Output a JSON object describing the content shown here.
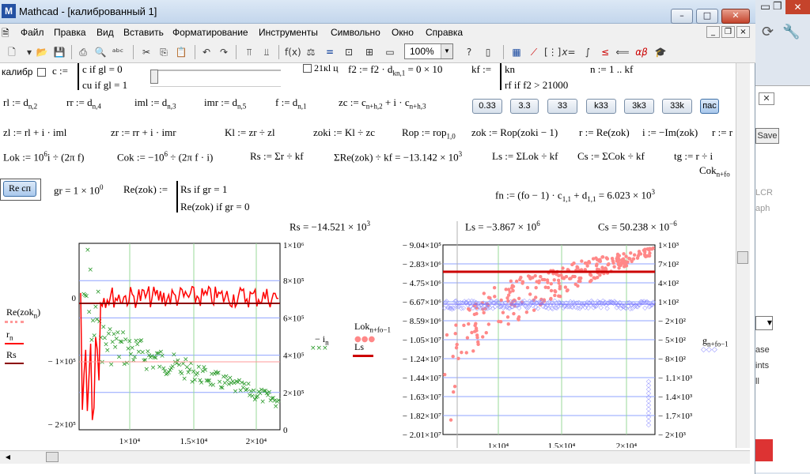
{
  "window": {
    "title": "Mathcad - [калиброванный 1]",
    "app_icon": "M"
  },
  "menu": [
    "Файл",
    "Правка",
    "Вид",
    "Вставить",
    "Форматирование",
    "Инструменты",
    "Символьно",
    "Окно",
    "Справка"
  ],
  "zoom": "100%",
  "sheet": {
    "row1": {
      "calib_label": "калибр",
      "cond1": "c if gl = 0",
      "cond2": "cu if gl = 1",
      "checkbox_label": "21кl ц",
      "f2_def": "f2 := f2 · d",
      "f2_sub": "kn,1",
      "f2_rest": " = 0 × 10",
      "kf": "kf :=",
      "kf1": "kn",
      "kf2": "rf  if  f2 > 21000",
      "nrange": "n := 1 .. kf"
    },
    "buttons": [
      "0.33",
      "3.3",
      "33",
      "k33",
      "3k3",
      "33k",
      "пас"
    ],
    "defs_row2": [
      "rl",
      "rr",
      "iml",
      "imr",
      "f",
      "zc"
    ],
    "row2": {
      "rl": "rl := d",
      "rl_sub": "n,2",
      "rr": "rr := d",
      "rr_sub": "n,4",
      "iml": "iml := d",
      "iml_sub": "n,3",
      "imr": "imr := d",
      "imr_sub": "n,5",
      "f": "f := d",
      "f_sub": "n,1",
      "zc": "zc := c",
      "zc_sub": "n+h,2",
      "zc_rest": " + i · c",
      "zc_sub2": "n+h,3"
    },
    "row3": {
      "zl": "zl := rl + i · iml",
      "zr": "zr := rr + i · imr",
      "kl": "Kl := zr ÷ zl",
      "zoki": "zoki := Kl ÷ zc",
      "rop": "Rop := rop",
      "rop_sub": "1,0",
      "zok": "zok := Rop(zoki − 1)",
      "r": "r := Re(zok)",
      "i": "i := −Im(zok)",
      "tail": "r := r"
    },
    "row4": {
      "lok": "Lok := 10",
      "lok_exp": "6",
      "lok_rest": "i ÷ (2π f)",
      "cok": "Cok := −10",
      "cok_exp": "6",
      "cok_rest": " ÷ (2π f · i)",
      "rs": "Rs := Σr ÷ kf",
      "re_sum": "ΣRe(zok) ÷ kf = −13.142 × 10",
      "re_sum_exp": "3",
      "ls": "Ls := ΣLok ÷ kf",
      "cs": "Cs := ΣCok ÷ kf",
      "tg": "tg := r ÷ i",
      "cok_tail": "Cok",
      "cok_tail_sub": "n+fo"
    },
    "row5": {
      "recsp_button": "Re сп",
      "gr": "gr = 1 × 10",
      "gr_exp": "0",
      "rez": "Re(zok) :=",
      "rez1": "Rs  if  gr = 1",
      "rez2": "Re(zok)  if  gr = 0",
      "fn": "fn := (fo − 1) · c",
      "fn_sub": "1,1",
      "fn_rest": " + d",
      "fn_sub2": "1,1",
      "fn_val": " = 6.023 × 10",
      "fn_exp": "3"
    },
    "results": {
      "rs": "Rs = −14.521 × 10",
      "rs_exp": "3",
      "ls": "Ls = −3.867 × 10",
      "ls_exp": "6",
      "cs": "Cs = 50.238 × 10",
      "cs_exp": "−6"
    }
  },
  "chart_data": [
    {
      "type": "line",
      "x_ticks": [
        "1×10⁴",
        "1.5×10⁴",
        "2×10⁴"
      ],
      "y_left_ticks": [
        "0",
        "− 1×10⁵",
        "− 2×10⁵"
      ],
      "y_right_ticks": [
        "1×10⁶",
        "8×10⁵",
        "6×10⁵",
        "4×10⁵",
        "2×10⁵",
        "0"
      ],
      "series": [
        {
          "name": "Re(zok_n)",
          "color": "#ff9999"
        },
        {
          "name": "r_n",
          "color": "#ff0000"
        },
        {
          "name": "Rs",
          "color": "#aa0000"
        },
        {
          "name": "− i_n",
          "color": "#2a9a2a"
        }
      ],
      "legend_left": [
        "Re(zok",
        "n",
        ")",
        "r",
        "n",
        "Rs"
      ],
      "legend_right": [
        "− i",
        "n"
      ]
    },
    {
      "type": "scatter",
      "x_ticks": [
        "1×10⁴",
        "1.5×10⁴",
        "2×10⁴"
      ],
      "y_left_ticks": [
        "− 9.04×10⁵",
        "− 2.83×10⁶",
        "− 4.75×10⁶",
        "− 6.67×10⁶",
        "− 8.59×10⁶",
        "− 1.05×10⁷",
        "− 1.24×10⁷",
        "− 1.44×10⁷",
        "− 1.63×10⁷",
        "− 1.82×10⁷",
        "− 2.01×10⁷"
      ],
      "y_right_ticks": [
        "1×10³",
        "7×10²",
        "4×10²",
        "1×10²",
        "− 2×10²",
        "− 5×10²",
        "− 8×10²",
        "− 1.1×10³",
        "− 1.4×10³",
        "− 1.7×10³",
        "− 2×10³"
      ],
      "series": [
        {
          "name": "Lok_(n+fo−1)",
          "color": "#ff8888"
        },
        {
          "name": "Ls",
          "color": "#cc0000"
        },
        {
          "name": "g_(n+fo−1)",
          "color": "#8888ff"
        }
      ],
      "legend_left": [
        "Lok",
        "n+fo−1",
        "Ls"
      ],
      "legend_right": [
        "g",
        "n+fo−1"
      ]
    }
  ],
  "right_panel": {
    "labels": [
      "Save",
      "LCR",
      "aph",
      "ase",
      "ints",
      "ll"
    ]
  }
}
